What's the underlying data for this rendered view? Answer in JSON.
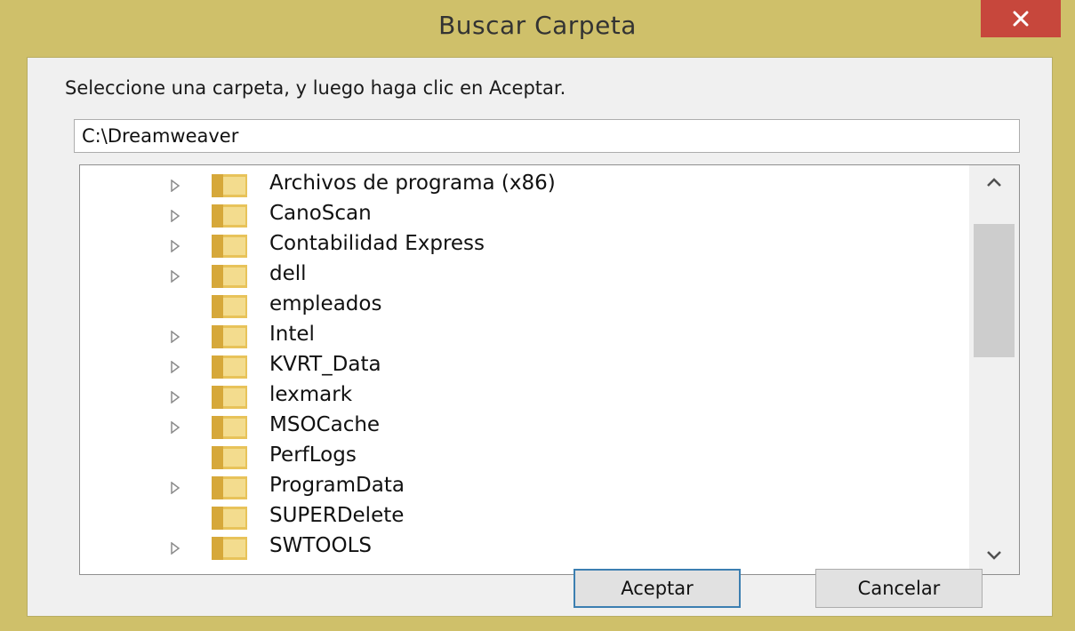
{
  "window": {
    "title": "Buscar Carpeta",
    "close_label": "×"
  },
  "dialog": {
    "instruction": "Seleccione una carpeta, y luego haga clic en Aceptar.",
    "path_value": "C:\\Dreamweaver"
  },
  "tree": {
    "items": [
      {
        "label": "Archivos de programa (x86)",
        "expandable": true
      },
      {
        "label": "CanoScan",
        "expandable": true
      },
      {
        "label": "Contabilidad Express",
        "expandable": true
      },
      {
        "label": "dell",
        "expandable": true
      },
      {
        "label": "empleados",
        "expandable": false
      },
      {
        "label": "Intel",
        "expandable": true
      },
      {
        "label": "KVRT_Data",
        "expandable": true
      },
      {
        "label": "lexmark",
        "expandable": true
      },
      {
        "label": "MSOCache",
        "expandable": true
      },
      {
        "label": "PerfLogs",
        "expandable": false
      },
      {
        "label": "ProgramData",
        "expandable": true
      },
      {
        "label": "SUPERDelete",
        "expandable": false
      },
      {
        "label": "SWTOOLS",
        "expandable": true
      }
    ]
  },
  "buttons": {
    "ok_label": "Aceptar",
    "cancel_label": "Cancelar"
  },
  "colors": {
    "frame": "#cfc06a",
    "close_button": "#c7473c",
    "folder": "#e8c35a",
    "default_button_border": "#3c7fb1"
  }
}
